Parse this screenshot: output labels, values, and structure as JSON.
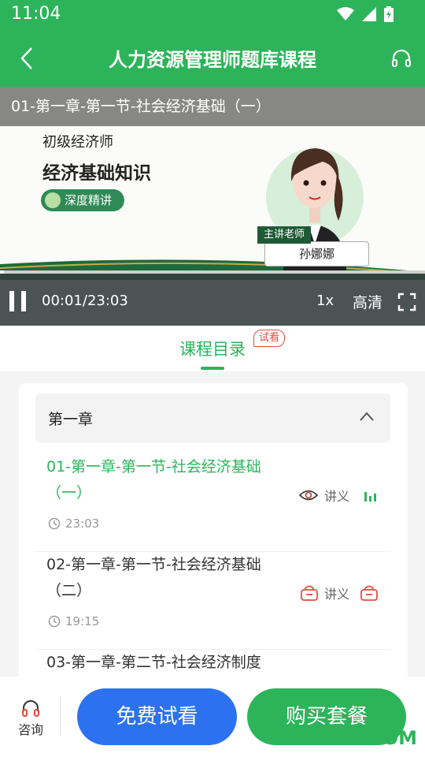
{
  "status": {
    "time": "11:04"
  },
  "header": {
    "title": "人力资源管理师题库课程"
  },
  "video": {
    "title": "01-第一章-第一节-社会经济基础（一）",
    "poster": {
      "line1": "初级经济师",
      "line2": "经济基础知识",
      "pill": "深度精讲",
      "teacher_label": "主讲老师",
      "teacher_name": "孙娜娜"
    },
    "time": "00:01/23:03",
    "progress": 0.001,
    "speed": "1x",
    "quality": "高清"
  },
  "tab": {
    "label": "课程目录",
    "badge": "试看"
  },
  "catalog": {
    "chapter": "第一章",
    "lessons": [
      {
        "title": "01-第一章-第一节-社会经济基础（一）",
        "duration": "23:03",
        "handout": "讲义",
        "state": "playing"
      },
      {
        "title": "02-第一章-第一节-社会经济基础（二）",
        "duration": "19:15",
        "handout": "讲义",
        "state": "locked"
      },
      {
        "title": "03-第一章-第二节-社会经济制度",
        "duration": "",
        "handout": "",
        "state": "locked"
      }
    ]
  },
  "bottom": {
    "consult": "咨询",
    "free": "免费试看",
    "buy": "购买套餐"
  },
  "watermark": "ITMOP.COM",
  "colors": {
    "accent": "#2db45a",
    "blue": "#2c72f0",
    "locked": "#e74c3c"
  }
}
